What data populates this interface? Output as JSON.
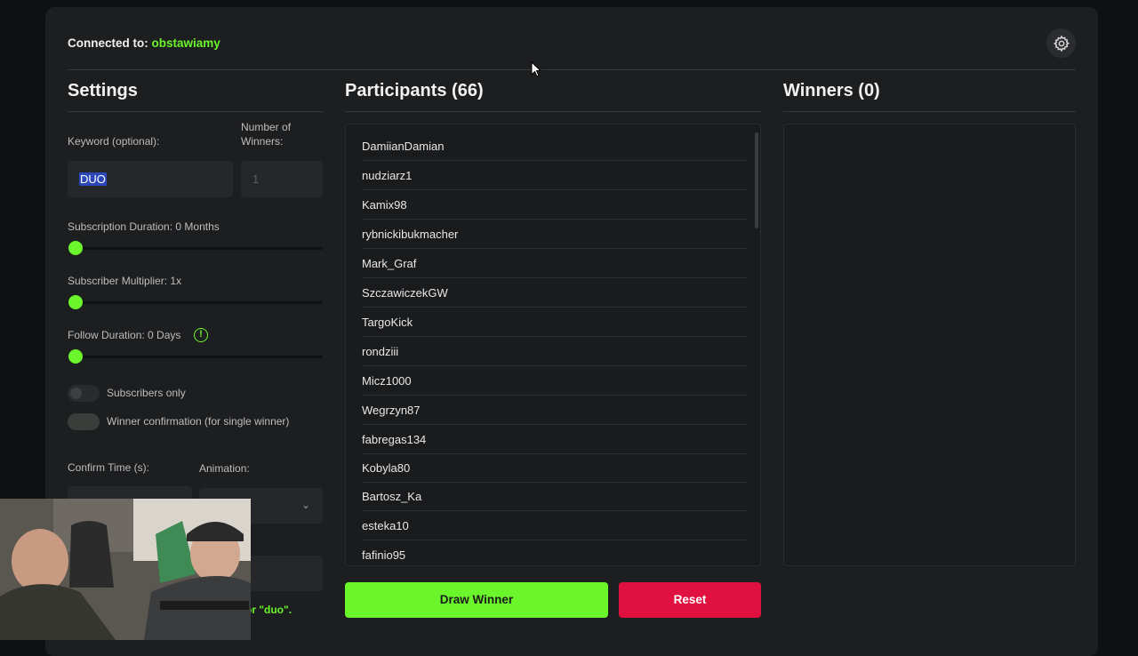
{
  "header": {
    "connected_label": "Connected to:",
    "channel": "obstawiamy"
  },
  "settings": {
    "title": "Settings",
    "keyword_label": "Keyword (optional):",
    "keyword_value": "DUO",
    "winners_label_1": "Number of",
    "winners_label_2": "Winners:",
    "winners_value": "1",
    "sub_duration_label": "Subscription Duration: 0 Months",
    "sub_multiplier_label": "Subscriber Multiplier: 1x",
    "follow_duration_label": "Follow Duration:  0  Days",
    "subscribers_only_label": "Subscribers only",
    "winner_confirm_label": "Winner confirmation (for single winner)",
    "confirm_time_label": "Confirm Time (s):",
    "animation_label": "Animation:",
    "hint_text": "or \"duo\"."
  },
  "participants": {
    "title": "Participants (66)",
    "items": [
      "DamiianDamian",
      "nudziarz1",
      "Kamix98",
      "rybnickibukmacher",
      "Mark_Graf",
      "SzczawiczekGW",
      "TargoKick",
      "rondziii",
      "Micz1000",
      "Wegrzyn87",
      "fabregas134",
      "Kobyla80",
      "Bartosz_Ka",
      "esteka10",
      "fafinio95"
    ]
  },
  "winners": {
    "title": "Winners (0)"
  },
  "actions": {
    "draw": "Draw Winner",
    "reset": "Reset"
  },
  "colors": {
    "accent": "#6bf52b",
    "danger": "#e0103f",
    "panel": "#1d1e20"
  },
  "icons": {
    "settings": "gear-icon",
    "info": "info-icon",
    "dropdown": "chevron-down-icon"
  }
}
